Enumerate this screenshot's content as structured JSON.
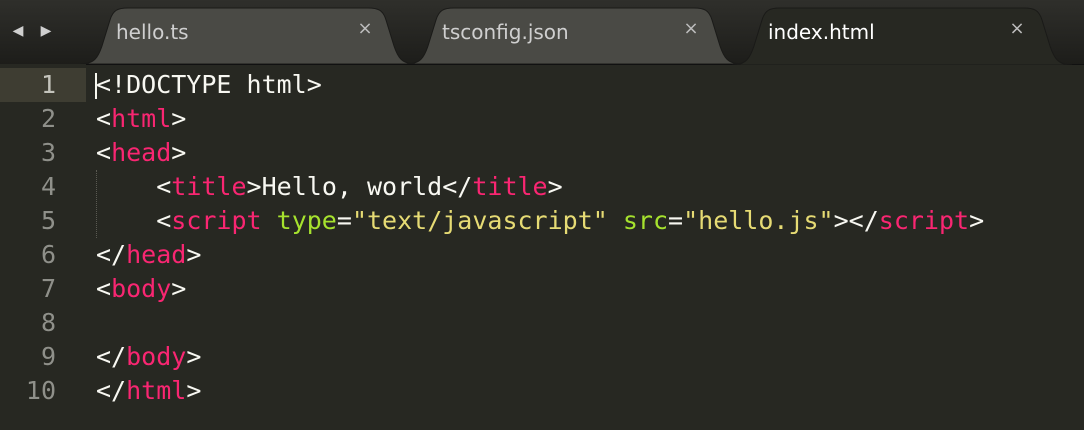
{
  "nav": {
    "back_icon": "◀",
    "forward_icon": "▶"
  },
  "tabs": [
    {
      "label": "hello.ts",
      "close": "×"
    },
    {
      "label": "tsconfig.json",
      "close": "×"
    },
    {
      "label": "index.html",
      "close": "×"
    }
  ],
  "line_numbers": [
    "1",
    "2",
    "3",
    "4",
    "5",
    "6",
    "7",
    "8",
    "9",
    "10"
  ],
  "code": {
    "l1": {
      "text": "<!DOCTYPE html>"
    },
    "l2": {
      "lt": "<",
      "tag": "html",
      "gt": ">"
    },
    "l3": {
      "lt": "<",
      "tag": "head",
      "gt": ">"
    },
    "l4": {
      "indent": "    ",
      "lt": "<",
      "tag": "title",
      "gt": ">",
      "text": "Hello, world",
      "lt2": "</",
      "tag2": "title",
      "gt2": ">"
    },
    "l5": {
      "indent": "    ",
      "lt": "<",
      "tag": "script",
      "sp": " ",
      "attr1": "type",
      "eq1": "=",
      "val1": "\"text/javascript\"",
      "sp2": " ",
      "attr2": "src",
      "eq2": "=",
      "val2": "\"hello.js\"",
      "gt": "></",
      "tag2": "script",
      "gt2": ">"
    },
    "l6": {
      "lt": "</",
      "tag": "head",
      "gt": ">"
    },
    "l7": {
      "lt": "<",
      "tag": "body",
      "gt": ">"
    },
    "l8": {
      "text": ""
    },
    "l9": {
      "lt": "</",
      "tag": "body",
      "gt": ">"
    },
    "l10": {
      "lt": "</",
      "tag": "html",
      "gt": ">"
    }
  },
  "colors": {
    "background": "#272822",
    "tag": "#f92672",
    "attribute": "#a6e22e",
    "string": "#e6db74",
    "text": "#f8f8f2",
    "line_number": "#8f908a"
  }
}
